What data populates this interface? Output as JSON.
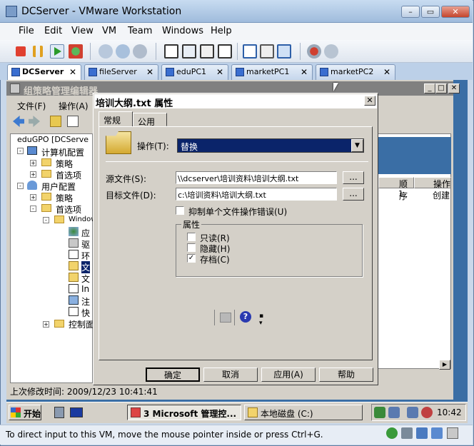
{
  "vmware": {
    "title": "DCServer - VMware Workstation",
    "menu": [
      "File",
      "Edit",
      "View",
      "VM",
      "Team",
      "Windows",
      "Help"
    ],
    "tabs": [
      {
        "label": "DCServer",
        "active": true
      },
      {
        "label": "fileServer",
        "active": false
      },
      {
        "label": "eduPC1",
        "active": false
      },
      {
        "label": "marketPC1",
        "active": false
      },
      {
        "label": "marketPC2",
        "active": false
      }
    ],
    "status_text": "To direct input to this VM, move the mouse pointer inside or press Ctrl+G."
  },
  "gpe": {
    "title": "组策略管理编辑器",
    "menu": [
      "文件(F)",
      "操作(A)"
    ],
    "tree": {
      "root": "eduGPO [DCServe",
      "computer": "计算机配置",
      "policy1": "策略",
      "pref1": "首选项",
      "user": "用户配置",
      "policy2": "策略",
      "pref2": "首选项",
      "windows": "Windows",
      "items": [
        "应",
        "驱",
        "环",
        "文",
        "文",
        "In",
        "注",
        "快"
      ],
      "control": "控制面"
    },
    "columns": [
      "顺序",
      "操作"
    ],
    "row": {
      "order": "1",
      "action": "创建"
    },
    "status": "上次修改时间: 2009/12/23 10:41:41"
  },
  "dialog": {
    "title": "培训大纲.txt 属性",
    "tabs": [
      "常规",
      "公用"
    ],
    "action_label": "操作(T):",
    "action_value": "替换",
    "source_label": "源文件(S):",
    "source_value": "\\\\dcserver\\培训资料\\培训大纲.txt",
    "target_label": "目标文件(D):",
    "target_value": "c:\\培训资料\\培训大纲.txt",
    "browse": "...",
    "suppress": "抑制单个文件操作错误(U)",
    "attr_group": "属性",
    "attrs": [
      {
        "label": "只读(R)",
        "checked": false
      },
      {
        "label": "隐藏(H)",
        "checked": false
      },
      {
        "label": "存档(C)",
        "checked": true
      }
    ],
    "buttons": [
      "确定",
      "取消",
      "应用(A)",
      "帮助"
    ]
  },
  "taskbar": {
    "start": "开始",
    "tasks": [
      "3 Microsoft 管理控...",
      "本地磁盘 (C:)"
    ],
    "clock": "10:42"
  }
}
